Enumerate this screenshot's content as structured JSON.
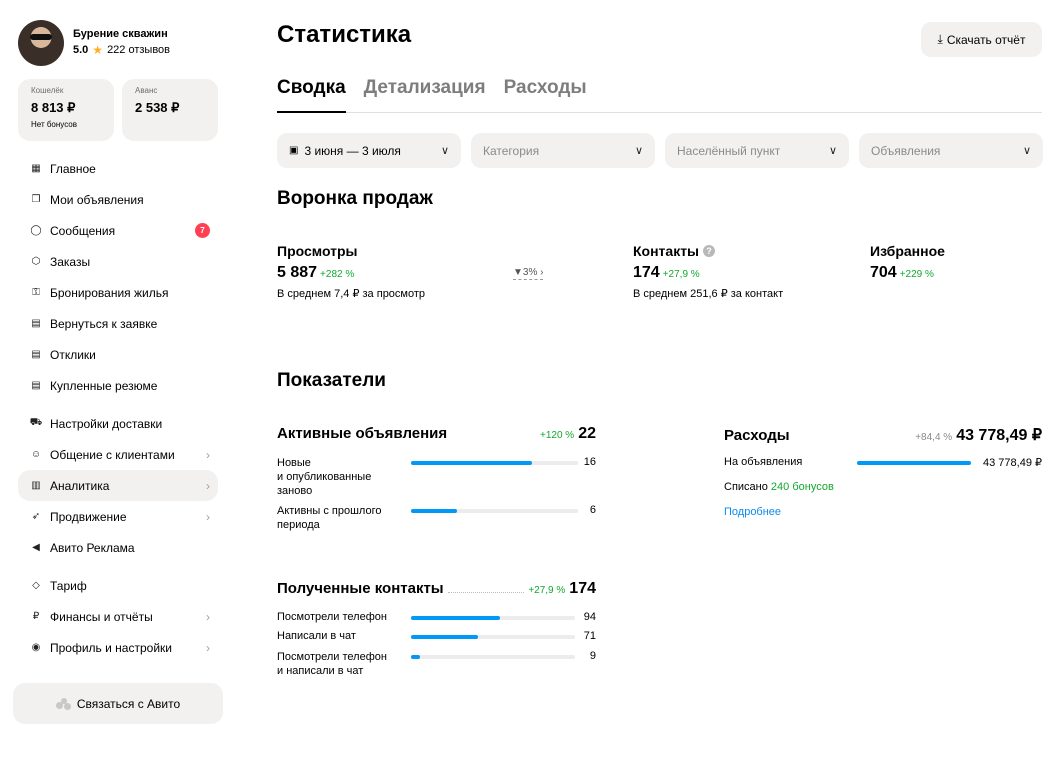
{
  "profile": {
    "name": "Бурение скважин",
    "rating": "5.0",
    "reviews": "222 отзывов"
  },
  "wallet": {
    "label": "Кошелёк",
    "value": "8 813 ₽",
    "sub": "Нет бонусов"
  },
  "advance": {
    "label": "Аванс",
    "value": "2 538 ₽"
  },
  "menu": {
    "items": [
      {
        "label": "Главное",
        "icon": "grid-icon"
      },
      {
        "label": "Мои объявления",
        "icon": "copy-icon"
      },
      {
        "label": "Сообщения",
        "icon": "chat-icon",
        "badge": "7"
      },
      {
        "label": "Заказы",
        "icon": "box-icon"
      },
      {
        "label": "Бронирования жилья",
        "icon": "key-icon"
      },
      {
        "label": "Вернуться к заявке",
        "icon": "doc-icon"
      },
      {
        "label": "Отклики",
        "icon": "doc-icon"
      },
      {
        "label": "Купленные резюме",
        "icon": "doc-icon"
      },
      {
        "label": "Настройки доставки",
        "icon": "truck-icon"
      },
      {
        "label": "Общение с клиентами",
        "icon": "people-icon"
      },
      {
        "label": "Аналитика",
        "icon": "chart-icon"
      },
      {
        "label": "Продвижение",
        "icon": "rocket-icon"
      },
      {
        "label": "Авито Реклама",
        "icon": "megaphone-icon"
      },
      {
        "label": "Тариф",
        "icon": "diamond-icon"
      },
      {
        "label": "Финансы и отчёты",
        "icon": "ruble-icon"
      },
      {
        "label": "Профиль и настройки",
        "icon": "user-icon"
      }
    ]
  },
  "contact_label": "Связаться с Авито",
  "page_title": "Статистика",
  "download_label": "Скачать отчёт",
  "tabs": [
    "Сводка",
    "Детализация",
    "Расходы"
  ],
  "filters": {
    "date": "3 июня — 3 июля",
    "category": "Категория",
    "city": "Населённый пункт",
    "ads": "Объявления"
  },
  "funnel": {
    "title": "Воронка продаж",
    "views": {
      "label": "Просмотры",
      "value": "5 887",
      "delta": "+282 %",
      "sub": "В среднем 7,4 ₽ за просмотр"
    },
    "conversion": "3%",
    "contacts": {
      "label": "Контакты",
      "value": "174",
      "delta": "+27,9 %",
      "sub": "В среднем 251,6 ₽ за контакт"
    },
    "favorites": {
      "label": "Избранное",
      "value": "704",
      "delta": "+229 %"
    }
  },
  "indicators": {
    "title": "Показатели",
    "active_ads": {
      "title": "Активные объявления",
      "delta": "+120 %",
      "value": "22",
      "rows": [
        {
          "label": "Новые\nи опубликованные\nзаново",
          "value": "16",
          "share": 0.727
        },
        {
          "label": "Активны с прошлого\nпериода",
          "value": "6",
          "share": 0.273
        }
      ]
    },
    "expenses": {
      "title": "Расходы",
      "delta": "+84,4 %",
      "value": "43 778,49 ₽",
      "row_label": "На объявления",
      "row_value": "43 778,49 ₽",
      "row_share": 1.0,
      "written_off": "Списано",
      "bonus": "240 бонусов",
      "more": "Подробнее"
    },
    "contacts": {
      "title": "Полученные контакты",
      "delta": "+27,9 %",
      "value": "174",
      "rows": [
        {
          "label": "Посмотрели телефон",
          "value": "94",
          "share": 0.54
        },
        {
          "label": "Написали в чат",
          "value": "71",
          "share": 0.408
        },
        {
          "label": "Посмотрели телефон\nи написали в чат",
          "value": "9",
          "share": 0.052
        }
      ]
    }
  }
}
